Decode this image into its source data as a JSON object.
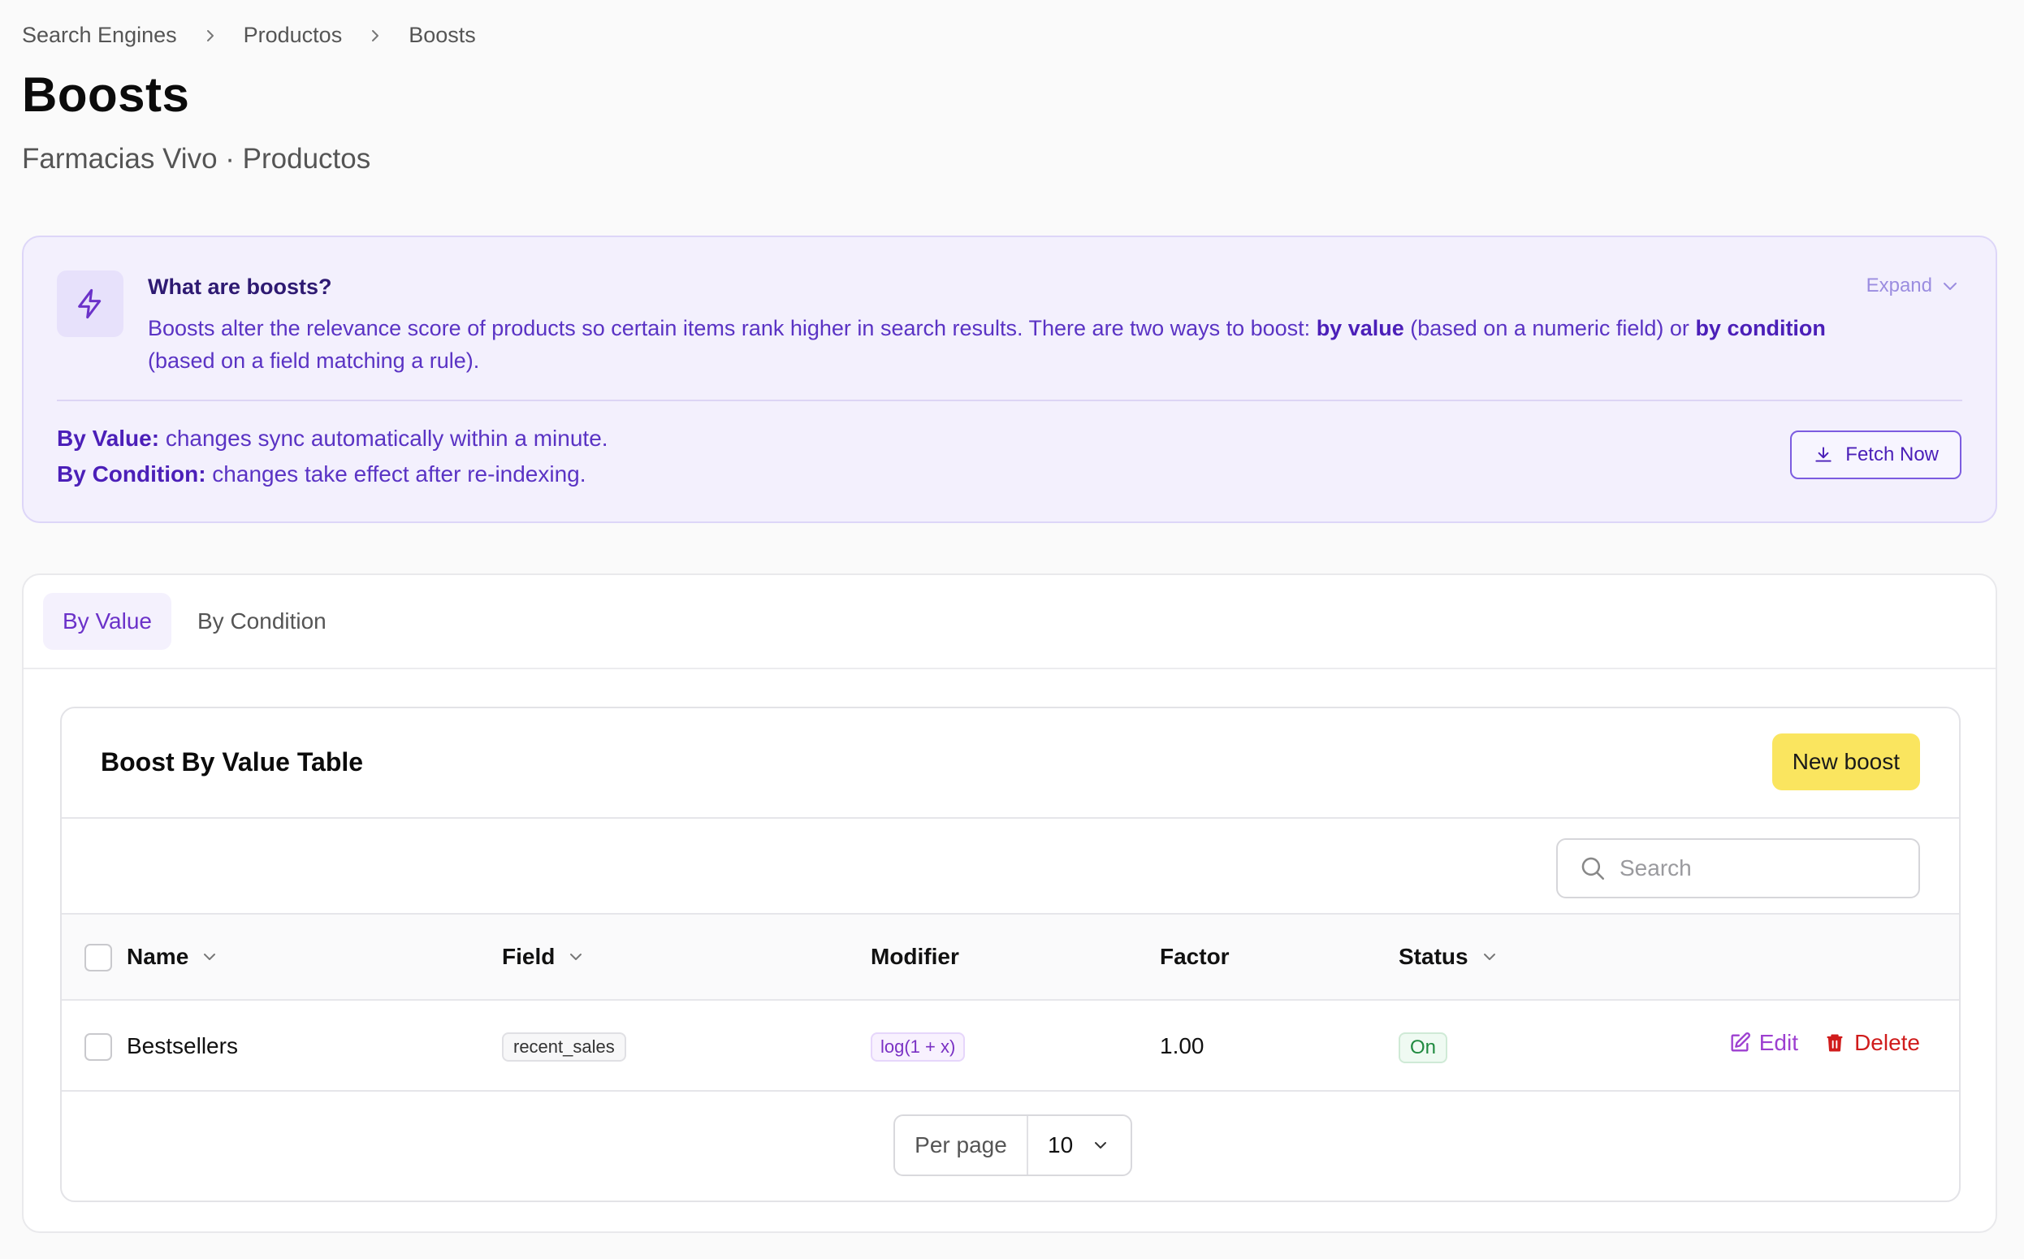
{
  "breadcrumb": [
    "Search Engines",
    "Productos",
    "Boosts"
  ],
  "page": {
    "title": "Boosts",
    "subtitle": "Farmacias Vivo · Productos"
  },
  "info": {
    "title": "What are boosts?",
    "desc_part1": "Boosts alter the relevance score of products so certain items rank higher in search results. There are two ways to boost: ",
    "desc_bold1": "by value",
    "desc_part2": " (based on a numeric field) or ",
    "desc_bold2": "by condition",
    "desc_part3": " (based on a field matching a rule).",
    "expand_label": "Expand",
    "value_label": "By Value:",
    "value_text": " changes sync automatically within a minute.",
    "condition_label": "By Condition:",
    "condition_text": " changes take effect after re-indexing.",
    "fetch_label": "Fetch Now"
  },
  "tabs": [
    {
      "label": "By Value",
      "active": true
    },
    {
      "label": "By Condition",
      "active": false
    }
  ],
  "table": {
    "title": "Boost By Value Table",
    "new_button": "New boost",
    "search_placeholder": "Search",
    "columns": [
      "Name",
      "Field",
      "Modifier",
      "Factor",
      "Status"
    ],
    "rows": [
      {
        "name": "Bestsellers",
        "field": "recent_sales",
        "modifier": "log(1 + x)",
        "factor": "1.00",
        "status": "On"
      }
    ],
    "edit_label": "Edit",
    "delete_label": "Delete",
    "per_page_label": "Per page",
    "per_page_value": "10"
  },
  "colors": {
    "accent": "#6b32c9",
    "info_bg": "#f3f0fd",
    "new_button_bg": "#fae55f",
    "status_on": "#1f8a3f",
    "delete": "#d01c1c"
  },
  "icons": {
    "breadcrumb_sep": "chevron-right-icon",
    "info": "lightning-icon",
    "expand": "chevron-down-icon",
    "fetch": "download-icon",
    "search": "search-icon",
    "sort": "chevron-down-icon",
    "edit": "edit-icon",
    "delete": "trash-icon"
  }
}
